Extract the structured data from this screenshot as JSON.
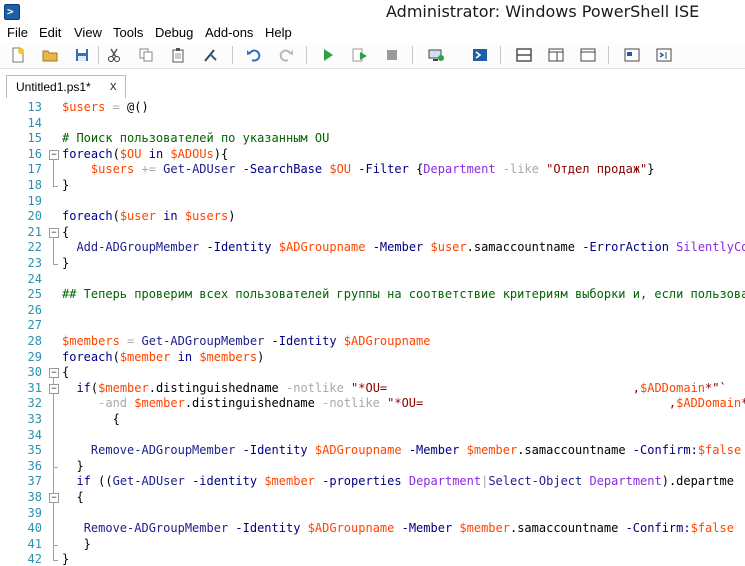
{
  "window": {
    "title": "Administrator: Windows PowerShell ISE"
  },
  "menu": [
    "File",
    "Edit",
    "View",
    "Tools",
    "Debug",
    "Add-ons",
    "Help"
  ],
  "toolbar": {
    "buttons": [
      "new-script",
      "open",
      "save",
      "cut",
      "copy",
      "paste",
      "clear-console",
      "undo",
      "redo",
      "run-script",
      "run-selection",
      "stop",
      "new-remote-tab",
      "start-powershell",
      "show-script-top",
      "show-script-right",
      "show-script-max",
      "show-command-window",
      "show-command-addon"
    ]
  },
  "tab": {
    "label": "Untitled1.ps1*",
    "close": "x"
  },
  "lines": [
    {
      "n": "13",
      "t": [
        [
          "v",
          "$users"
        ],
        [
          "o",
          " = "
        ],
        [
          "",
          "@()"
        ]
      ]
    },
    {
      "n": "14",
      "t": []
    },
    {
      "n": "15",
      "t": [
        [
          "cm",
          "# Поиск пользователей по указанным OU"
        ]
      ]
    },
    {
      "n": "16",
      "t": [
        [
          "k",
          "foreach"
        ],
        [
          "",
          "("
        ],
        [
          "v",
          "$OU"
        ],
        [
          "",
          " "
        ],
        [
          "k",
          "in"
        ],
        [
          "",
          " "
        ],
        [
          "v",
          "$ADOUs"
        ],
        [
          "",
          "){"
        ]
      ]
    },
    {
      "n": "17",
      "t": [
        [
          "",
          "    "
        ],
        [
          "v",
          "$users"
        ],
        [
          "o",
          " += "
        ],
        [
          "c",
          "Get-ADUser"
        ],
        [
          "p",
          " -SearchBase"
        ],
        [
          "",
          " "
        ],
        [
          "v",
          "$OU"
        ],
        [
          "p",
          " -Filter"
        ],
        [
          "",
          " {"
        ],
        [
          "a",
          "Department"
        ],
        [
          "o",
          " -like "
        ],
        [
          "s",
          "\"Отдел продаж\""
        ],
        [
          "",
          "}"
        ]
      ]
    },
    {
      "n": "18",
      "t": [
        [
          "",
          "}"
        ]
      ]
    },
    {
      "n": "19",
      "t": []
    },
    {
      "n": "20",
      "t": [
        [
          "k",
          "foreach"
        ],
        [
          "",
          "("
        ],
        [
          "v",
          "$user"
        ],
        [
          "",
          " "
        ],
        [
          "k",
          "in"
        ],
        [
          "",
          " "
        ],
        [
          "v",
          "$users"
        ],
        [
          "",
          ")"
        ]
      ]
    },
    {
      "n": "21",
      "t": [
        [
          "",
          "{"
        ]
      ]
    },
    {
      "n": "22",
      "t": [
        [
          "",
          "  "
        ],
        [
          "c",
          "Add-ADGroupMember"
        ],
        [
          "p",
          " -Identity"
        ],
        [
          "",
          " "
        ],
        [
          "v",
          "$ADGroupname"
        ],
        [
          "p",
          " -Member"
        ],
        [
          "",
          " "
        ],
        [
          "v",
          "$user"
        ],
        [
          "",
          ".samaccountname"
        ],
        [
          "p",
          " -ErrorAction"
        ],
        [
          "",
          " "
        ],
        [
          "a",
          "SilentlyCo"
        ]
      ]
    },
    {
      "n": "23",
      "t": [
        [
          "",
          "}"
        ]
      ]
    },
    {
      "n": "24",
      "t": []
    },
    {
      "n": "25",
      "t": [
        [
          "cm",
          "## Теперь проверим всех пользователей группы на соответствие критериям выборки и, если пользоват"
        ]
      ]
    },
    {
      "n": "26",
      "t": []
    },
    {
      "n": "27",
      "t": []
    },
    {
      "n": "28",
      "t": [
        [
          "v",
          "$members"
        ],
        [
          "o",
          " = "
        ],
        [
          "c",
          "Get-ADGroupMember"
        ],
        [
          "p",
          " -Identity"
        ],
        [
          "",
          " "
        ],
        [
          "v",
          "$ADGroupname"
        ]
      ]
    },
    {
      "n": "29",
      "t": [
        [
          "k",
          "foreach"
        ],
        [
          "",
          "("
        ],
        [
          "v",
          "$member"
        ],
        [
          "",
          " "
        ],
        [
          "k",
          "in"
        ],
        [
          "",
          " "
        ],
        [
          "v",
          "$members"
        ],
        [
          "",
          ")"
        ]
      ]
    },
    {
      "n": "30",
      "t": [
        [
          "",
          "{"
        ]
      ]
    },
    {
      "n": "31",
      "t": [
        [
          "",
          "  "
        ],
        [
          "k",
          "if"
        ],
        [
          "",
          "("
        ],
        [
          "v",
          "$member"
        ],
        [
          "",
          ".distinguishedname"
        ],
        [
          "o",
          " -notlike "
        ],
        [
          "s",
          "\"*OU=                                  ,"
        ],
        [
          "v",
          "$ADDomain"
        ],
        [
          "s",
          "*\""
        ],
        [
          "",
          "`"
        ]
      ]
    },
    {
      "n": "32",
      "t": [
        [
          "",
          "     "
        ],
        [
          "o",
          "-and "
        ],
        [
          "v",
          "$member"
        ],
        [
          "",
          ".distinguishedname"
        ],
        [
          "o",
          " -notlike "
        ],
        [
          "s",
          "\"*OU=                                  ,"
        ],
        [
          "v",
          "$ADDomain"
        ],
        [
          "s",
          "*\""
        ],
        [
          "",
          ")"
        ]
      ]
    },
    {
      "n": "33",
      "t": [
        [
          "",
          "       {"
        ]
      ]
    },
    {
      "n": "34",
      "t": []
    },
    {
      "n": "35",
      "t": [
        [
          "",
          "    "
        ],
        [
          "c",
          "Remove-ADGroupMember"
        ],
        [
          "p",
          " -Identity"
        ],
        [
          "",
          " "
        ],
        [
          "v",
          "$ADGroupname"
        ],
        [
          "p",
          " -Member"
        ],
        [
          "",
          " "
        ],
        [
          "v",
          "$member"
        ],
        [
          "",
          ".samaccountname"
        ],
        [
          "p",
          " -Confirm:"
        ],
        [
          "v",
          "$false"
        ]
      ]
    },
    {
      "n": "36",
      "t": [
        [
          "",
          "  }"
        ]
      ]
    },
    {
      "n": "37",
      "t": [
        [
          "",
          "  "
        ],
        [
          "k",
          "if"
        ],
        [
          "",
          " (("
        ],
        [
          "c",
          "Get-ADUser"
        ],
        [
          "p",
          " -identity"
        ],
        [
          "",
          " "
        ],
        [
          "v",
          "$member"
        ],
        [
          "p",
          " -properties"
        ],
        [
          "",
          " "
        ],
        [
          "a",
          "Department"
        ],
        [
          "o",
          "|"
        ],
        [
          "c",
          "Select-Object"
        ],
        [
          "",
          ""
        ],
        [
          "",
          " "
        ],
        [
          "a",
          "Department"
        ],
        [
          "",
          ").departme"
        ]
      ]
    },
    {
      "n": "38",
      "t": [
        [
          "",
          "  {"
        ]
      ]
    },
    {
      "n": "39",
      "t": []
    },
    {
      "n": "40",
      "t": [
        [
          "",
          "   "
        ],
        [
          "c",
          "Remove-ADGroupMember"
        ],
        [
          "p",
          " -Identity"
        ],
        [
          "",
          " "
        ],
        [
          "v",
          "$ADGroupname"
        ],
        [
          "p",
          " -Member"
        ],
        [
          "",
          " "
        ],
        [
          "v",
          "$member"
        ],
        [
          "",
          ".samaccountname"
        ],
        [
          "p",
          " -Confirm:"
        ],
        [
          "v",
          "$false"
        ]
      ]
    },
    {
      "n": "41",
      "t": [
        [
          "",
          "   }"
        ]
      ]
    },
    {
      "n": "42",
      "t": [
        [
          "",
          "}"
        ]
      ]
    }
  ]
}
